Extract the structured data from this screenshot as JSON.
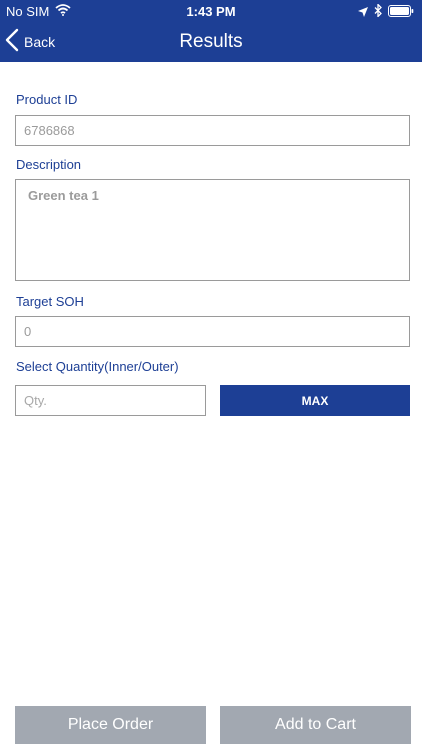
{
  "status_bar": {
    "carrier": "No SIM",
    "time": "1:43 PM"
  },
  "nav": {
    "back_label": "Back",
    "title": "Results"
  },
  "form": {
    "product_id_label": "Product ID",
    "product_id_value": "6786868",
    "description_label": "Description",
    "description_value": "Green tea 1",
    "target_soh_label": "Target SOH",
    "target_soh_value": "0",
    "quantity_label": "Select Quantity(Inner/Outer)",
    "quantity_placeholder": "Qty.",
    "max_label": "MAX"
  },
  "actions": {
    "place_order_label": "Place Order",
    "add_to_cart_label": "Add to Cart"
  },
  "colors": {
    "brand": "#1d3f95",
    "disabled_button": "#a2a8b1",
    "border": "#9a9a9a",
    "placeholder_text": "#9b9b9b"
  }
}
